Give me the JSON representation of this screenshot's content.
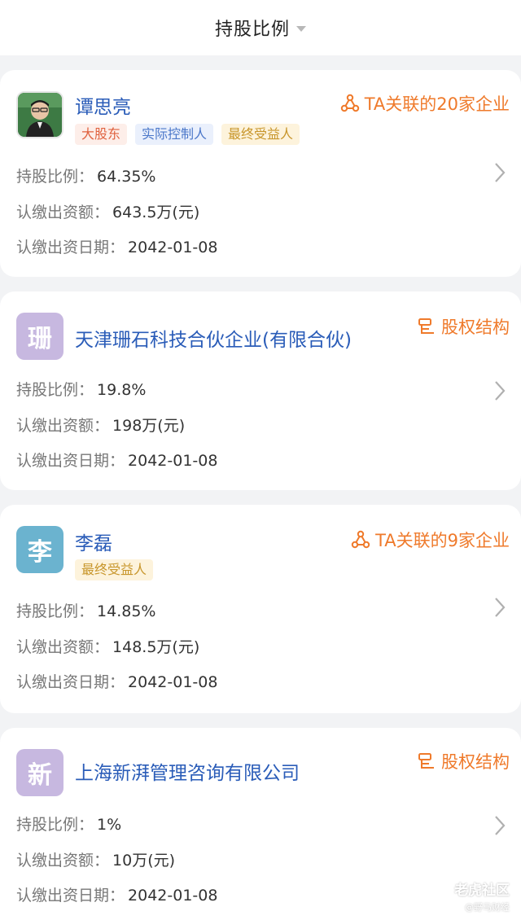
{
  "header": {
    "title": "持股比例"
  },
  "labels": {
    "ratio": "持股比例：",
    "amount": "认缴出资额：",
    "date": "认缴出资日期："
  },
  "shareholders": [
    {
      "name": "谭思亮",
      "avatar_type": "photo",
      "tags": [
        "大股东",
        "实际控制人",
        "最终受益人"
      ],
      "link": "TA关联的20家企业",
      "ratio": "64.35%",
      "amount": "643.5万(元)",
      "date": "2042-01-08"
    },
    {
      "name": "天津珊石科技合伙企业(有限合伙)",
      "avatar_char": "珊",
      "avatar_color": "#c7b8e0",
      "link": "股权结构",
      "ratio": "19.8%",
      "amount": "198万(元)",
      "date": "2042-01-08"
    },
    {
      "name": "李磊",
      "avatar_char": "李",
      "avatar_color": "#6bb3cf",
      "tags": [
        "最终受益人"
      ],
      "link": "TA关联的9家企业",
      "ratio": "14.85%",
      "amount": "148.5万(元)",
      "date": "2042-01-08"
    },
    {
      "name": "上海新湃管理咨询有限公司",
      "avatar_char": "新",
      "avatar_color": "#c7b8e0",
      "link": "股权结构",
      "ratio": "1%",
      "amount": "10万(元)",
      "date": "2042-01-08"
    }
  ],
  "watermark": {
    "main": "老虎社区",
    "sub": "@野马财经"
  },
  "colors": {
    "accent_orange": "#ef7a2b",
    "name_blue": "#2a5cb8"
  }
}
